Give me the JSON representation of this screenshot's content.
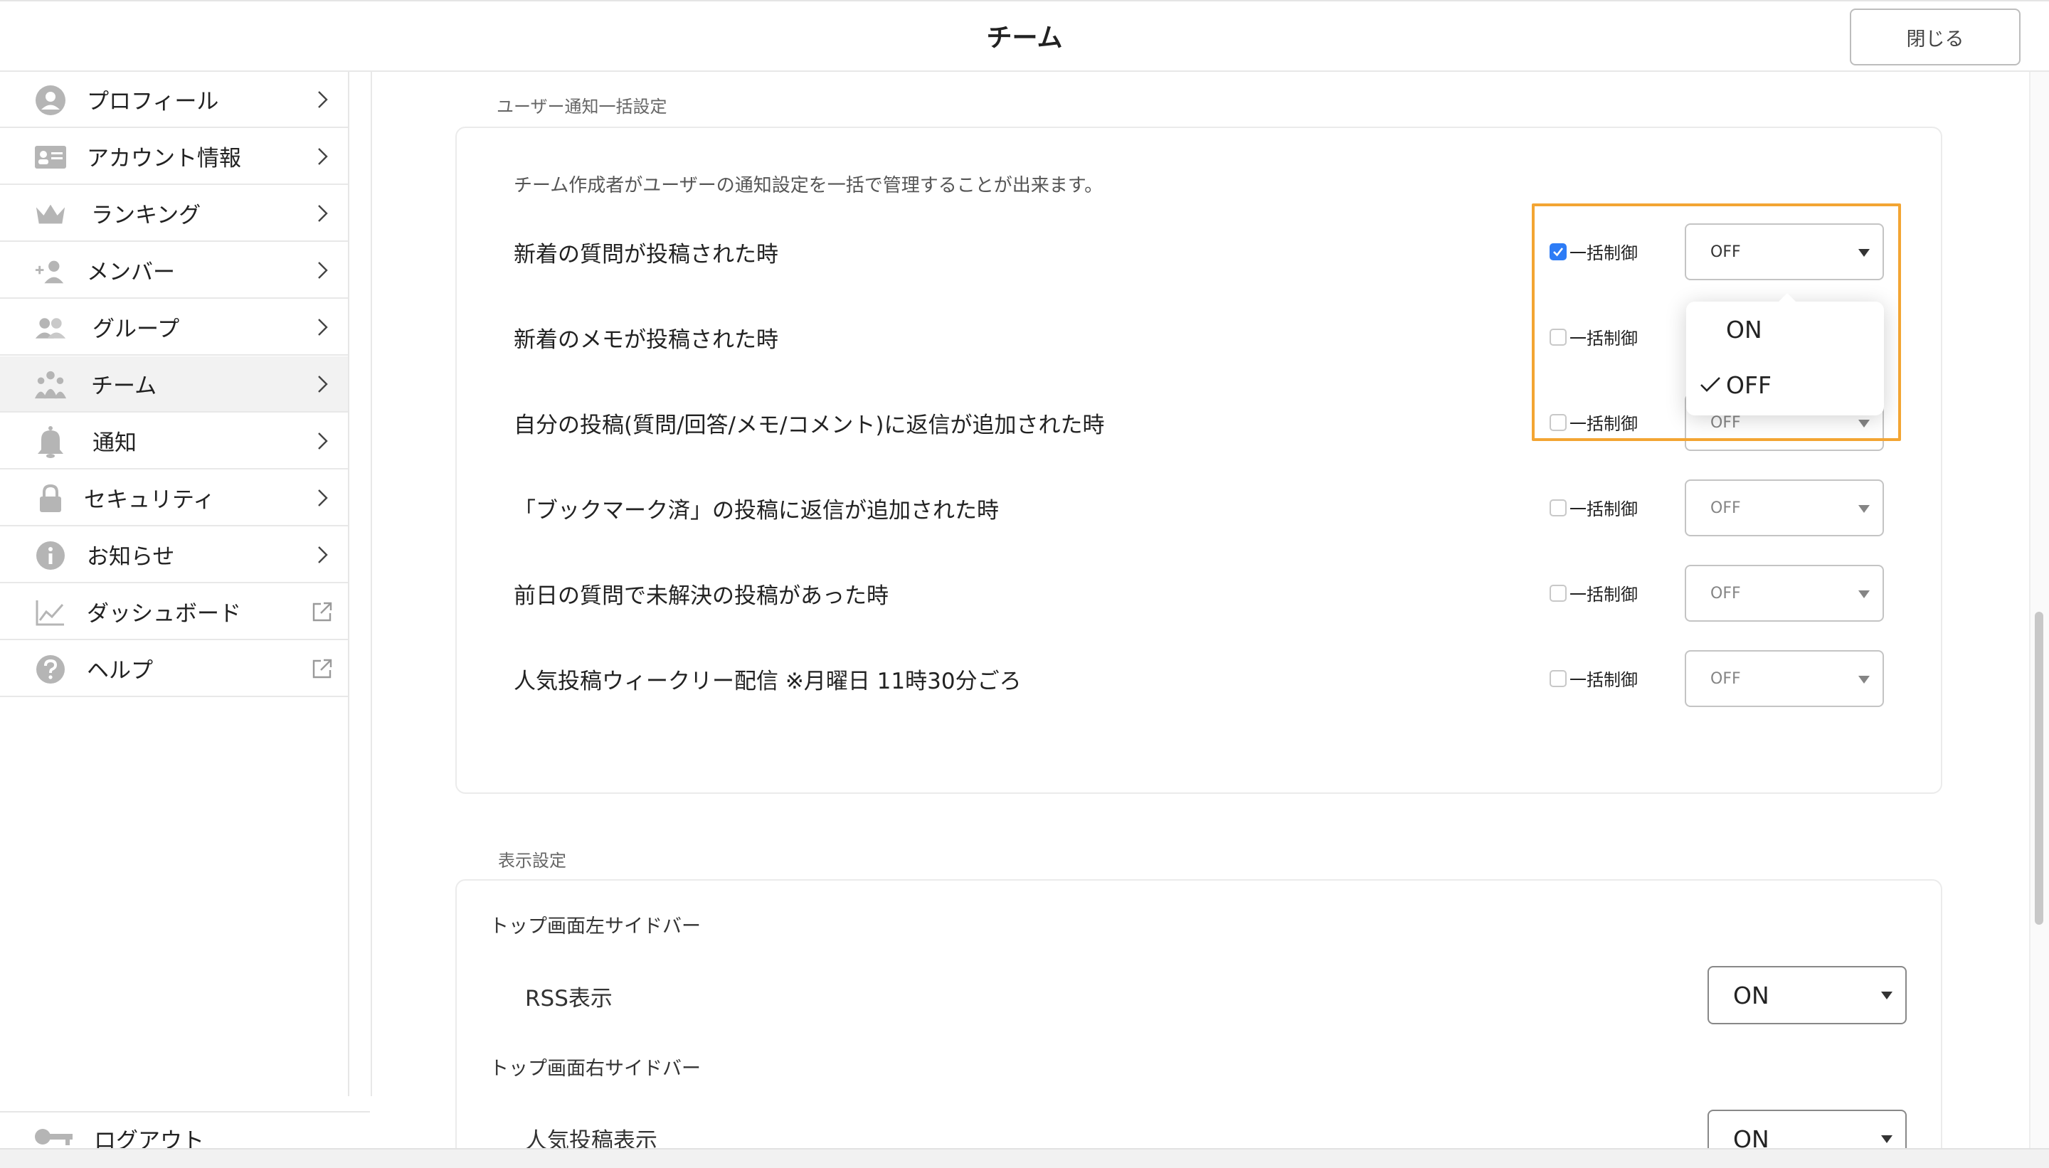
{
  "header": {
    "title": "チーム",
    "close_label": "閉じる"
  },
  "sidebar": {
    "items": [
      {
        "label": "プロフィール",
        "icon": "user-icon"
      },
      {
        "label": "アカウント情報",
        "icon": "id-card-icon"
      },
      {
        "label": "ランキング",
        "icon": "crown-icon"
      },
      {
        "label": "メンバー",
        "icon": "add-user-icon"
      },
      {
        "label": "グループ",
        "icon": "group-icon"
      },
      {
        "label": "チーム",
        "icon": "team-icon",
        "active": true
      },
      {
        "label": "通知",
        "icon": "bell-icon"
      },
      {
        "label": "セキュリティ",
        "icon": "lock-icon"
      },
      {
        "label": "お知らせ",
        "icon": "info-icon"
      },
      {
        "label": "ダッシュボード",
        "icon": "chart-icon",
        "external": true
      },
      {
        "label": "ヘルプ",
        "icon": "help-icon",
        "external": true
      }
    ],
    "logout_label": "ログアウト"
  },
  "notify": {
    "section_title": "ユーザー通知一括設定",
    "description": "チーム作成者がユーザーの通知設定を一括で管理することが出来ます。",
    "checkbox_label": "一括制御",
    "rows": [
      {
        "label": "新着の質問が投稿された時",
        "checked": true,
        "value": "OFF"
      },
      {
        "label": "新着のメモが投稿された時",
        "checked": false,
        "value": "OFF"
      },
      {
        "label": "自分の投稿(質問/回答/メモ/コメント)に返信が追加された時",
        "checked": false,
        "value": "OFF"
      },
      {
        "label": "「ブックマーク済」の投稿に返信が追加された時",
        "checked": false,
        "value": "OFF"
      },
      {
        "label": "前日の質問で未解決の投稿があった時",
        "checked": false,
        "value": "OFF"
      },
      {
        "label": "人気投稿ウィークリー配信 ※月曜日 11時30分ごろ",
        "checked": false,
        "value": "OFF"
      }
    ],
    "dropdown_options": [
      "ON",
      "OFF"
    ],
    "dropdown_selected": "OFF"
  },
  "display": {
    "section_title": "表示設定",
    "left_sidebar_title": "トップ画面左サイドバー",
    "rss_label": "RSS表示",
    "rss_value": "ON",
    "right_sidebar_title": "トップ画面右サイドバー",
    "popular_label": "人気投稿表示",
    "popular_value": "ON"
  },
  "colors": {
    "accent": "#f3a533",
    "checkbox": "#2d7cf6"
  }
}
